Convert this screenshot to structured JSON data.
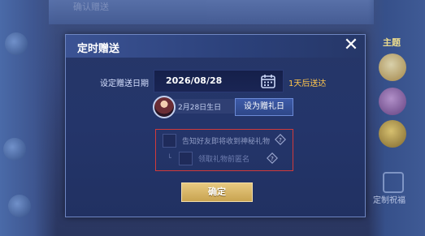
{
  "background": {
    "top_tab": "确认赠送",
    "right_panel": {
      "tab_label": "主题",
      "bottom_label": "定制祝福"
    }
  },
  "dialog": {
    "title": "定时赠送",
    "close_label": "✕",
    "date_label": "设定赠送日期",
    "date_value": "2026/08/28",
    "after_days": "1天后送达",
    "birthday_text": "2月28日生日",
    "set_gift_day_label": "设为赠礼日",
    "options": {
      "notify_friend": "告知好友即将收到神秘礼物",
      "sign_name": "领取礼物前匿名"
    },
    "confirm_label": "确定"
  },
  "colors": {
    "accent_gold": "#ffc64d",
    "button_gold": "#c9a451",
    "dialog_bg": "#24356a",
    "highlight_red": "#d13a3a"
  },
  "icons": {
    "calendar": "calendar-icon",
    "close": "close-icon",
    "info": "diamond-info-icon"
  }
}
